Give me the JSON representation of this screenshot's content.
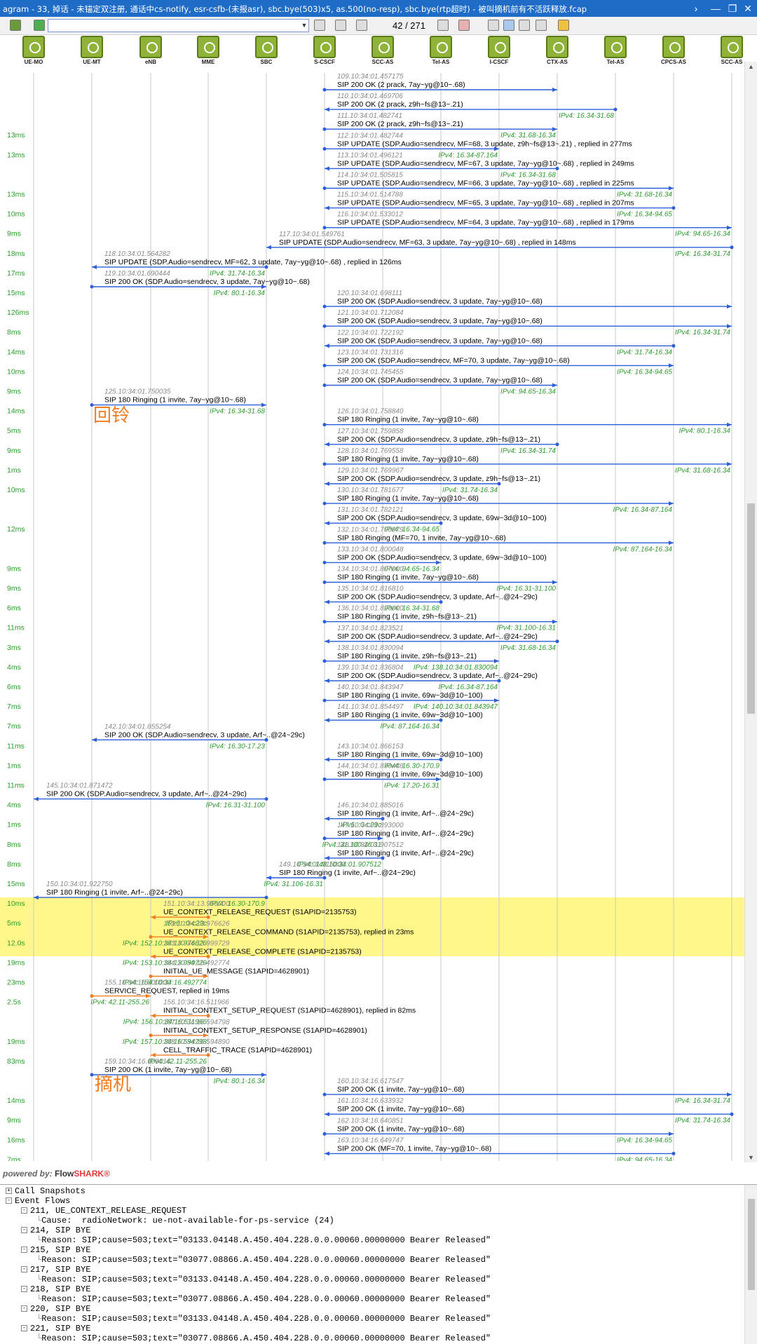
{
  "window": {
    "title": "agram - 33, 掉话 - 未锚定双注册, 通话中cs-notify, esr-csfb-(未报asr), sbc.bye(503)x5, as.500(no-resp), sbc.bye(rtp超时) - 被叫摘机前有不活跃释放.fcap",
    "close": "✕",
    "max": "❐",
    "min": "—",
    "next": "›"
  },
  "toolbar": {
    "page": "42 / 271"
  },
  "entities": [
    "UE-MO",
    "UE-MT",
    "eNB",
    "MME",
    "SBC",
    "S-CSCF",
    "SCC-AS",
    "Tel-AS",
    "I-CSCF",
    "CTX-AS",
    "Tel-AS",
    "CPCS-AS",
    "SCC-AS"
  ],
  "annotations": {
    "ringback": "回铃",
    "offhook": "摘机"
  },
  "colors": {
    "signal": "#2d5fd8",
    "arrow_red": "#f07d23",
    "highlight": "#fff78a",
    "delta": "#2a9d2a",
    "ipv": "#2e9b2e"
  },
  "messages": [
    {
      "d": "",
      "id": "109.10:34:01.457175",
      "t": "SIP 200 OK (2 prack, 7ay~yg@10~.68)",
      "ip": "",
      "f": 5,
      "to": 9
    },
    {
      "d": "",
      "id": "110.10:34:01.469706",
      "t": "SIP 200 OK (2 prack, z9h~fs@13~.21)",
      "ip": "IPv4: 16.34-31.68",
      "f": 10,
      "to": 5
    },
    {
      "d": "13ms",
      "id": "111.10:34:01.482741",
      "t": "SIP 200 OK (2 prack, z9h~fs@13~.21)",
      "ip": "IPv4: 31.68-16.34",
      "f": 5,
      "to": 9
    },
    {
      "d": "13ms",
      "id": "112.10:34:01.482744",
      "t": "SIP UPDATE (SDP.Audio=sendrecv, MF=68, 3 update, z9h~fs@13~.21) , replied in 277ms",
      "ip": "IPv4: 16.34-87.164",
      "f": 5,
      "to": 8
    },
    {
      "d": "",
      "id": "113.10:34:01.496121",
      "t": "SIP UPDATE (SDP.Audio=sendrecv, MF=67, 3 update, 7ay~yg@10~.68) , replied in 249ms",
      "ip": "IPv4: 16.34-31.68",
      "f": 9,
      "to": 5
    },
    {
      "d": "13ms",
      "id": "114.10:34:01.505815",
      "t": "SIP UPDATE (SDP.Audio=sendrecv, MF=66, 3 update, 7ay~yg@10~.68) , replied in 225ms",
      "ip": "IPv4: 31.68-16.34",
      "f": 5,
      "to": 11
    },
    {
      "d": "10ms",
      "id": "115.10:34:01.514788",
      "t": "SIP UPDATE (SDP.Audio=sendrecv, MF=65, 3 update, 7ay~yg@10~.68) , replied in 207ms",
      "ip": "IPv4: 16.34-94.65",
      "f": 11,
      "to": 5
    },
    {
      "d": "9ms",
      "id": "116.10:34:01.533012",
      "t": "SIP UPDATE (SDP.Audio=sendrecv, MF=64, 3 update, 7ay~yg@10~.68) , replied in 179ms",
      "ip": "IPv4: 94.65-16.34",
      "f": 5,
      "to": 12
    },
    {
      "d": "18ms",
      "id": "117.10:34:01.549761",
      "t": "SIP UPDATE (SDP.Audio=sendrecv, MF=63, 3 update, 7ay~yg@10~.68) , replied in 148ms",
      "ip": "IPv4: 16.34-31.74",
      "f": 12,
      "to": 4
    },
    {
      "d": "17ms",
      "id": "118.10:34:01.564282",
      "t": "SIP UPDATE (SDP.Audio=sendrecv, MF=62, 3 update, 7ay~yg@10~.68) , replied in 126ms",
      "ip": "IPv4: 31.74-16.34",
      "f": 4,
      "to": 1
    },
    {
      "d": "15ms",
      "id": "119.10:34:01.690444",
      "t": "SIP 200 OK (SDP.Audio=sendrecv, 3 update, 7ay~yg@10~.68)",
      "ip": "IPv4: 80.1-16.34",
      "f": 1,
      "to": 4
    },
    {
      "d": "126ms",
      "id": "120.10:34:01.698111",
      "t": "SIP 200 OK (SDP.Audio=sendrecv, 3 update, 7ay~yg@10~.68)",
      "ip": "",
      "f": 5,
      "to": 12
    },
    {
      "d": "8ms",
      "id": "121.10:34:01.712084",
      "t": "SIP 200 OK (SDP.Audio=sendrecv, 3 update, 7ay~yg@10~.68)",
      "ip": "IPv4: 16.34-31.74",
      "f": 5,
      "to": 12
    },
    {
      "d": "14ms",
      "id": "122.10:34:01.722192",
      "t": "SIP 200 OK (SDP.Audio=sendrecv, 3 update, 7ay~yg@10~.68)",
      "ip": "IPv4: 31.74-16.34",
      "f": 11,
      "to": 5
    },
    {
      "d": "10ms",
      "id": "123.10:34:01.731316",
      "t": "SIP 200 OK (SDP.Audio=sendrecv, MF=70, 3 update, 7ay~yg@10~.68)",
      "ip": "IPv4: 16.34-94.65",
      "f": 5,
      "to": 11
    },
    {
      "d": "9ms",
      "id": "124.10:34:01.745455",
      "t": "SIP 200 OK (SDP.Audio=sendrecv, 3 update, 7ay~yg@10~.68)",
      "ip": "IPv4: 94.65-16.34",
      "f": 5,
      "to": 9
    },
    {
      "d": "14ms",
      "id": "125.10:34:01.750035",
      "t": "SIP 180 Ringing (1 invite, 7ay~yg@10~.68)",
      "ip": "IPv4: 16.34-31.68",
      "f": 1,
      "to": 4
    },
    {
      "d": "5ms",
      "id": "126.10:34:01.758840",
      "t": "SIP 180 Ringing (1 invite, 7ay~yg@10~.68)",
      "ip": "IPv4: 80.1-16.34",
      "f": 5,
      "to": 12
    },
    {
      "d": "9ms",
      "id": "127.10:34:01.759858",
      "t": "SIP 200 OK (SDP.Audio=sendrecv, 3 update, z9h~fs@13~.21)",
      "ip": "IPv4: 16.34-31.74",
      "f": 9,
      "to": 5
    },
    {
      "d": "1ms",
      "id": "128.10:34:01.769558",
      "t": "SIP 180 Ringing (1 invite, 7ay~yg@10~.68)",
      "ip": "IPv4: 31.68-16.34",
      "f": 5,
      "to": 12
    },
    {
      "d": "10ms",
      "id": "129.10:34:01.769967",
      "t": "SIP 200 OK (SDP.Audio=sendrecv, 3 update, z9h~fs@13~.21)",
      "ip": "IPv4: 31.74-16.34",
      "f": 8,
      "to": 5
    },
    {
      "d": "",
      "id": "130.10:34:01.781677",
      "t": "SIP 180 Ringing (1 invite, 7ay~yg@10~.68)",
      "ip": "IPv4: 16.34-87.164",
      "f": 5,
      "to": 11
    },
    {
      "d": "12ms",
      "id": "131.10:34:01.782121",
      "t": "SIP 200 OK (SDP.Audio=sendrecv, 3 update, 69w~3d@10~100)",
      "ip": "IPv4: 16.34-94.65",
      "f": 7,
      "to": 5
    },
    {
      "d": "",
      "id": "132.10:34:01.790979",
      "t": "SIP 180 Ringing (MF=70, 1 invite, 7ay~yg@10~.68)",
      "ip": "IPv4: 87.164-16.34",
      "f": 5,
      "to": 11
    },
    {
      "d": "9ms",
      "id": "133.10:34:01.800048",
      "t": "SIP 200 OK (SDP.Audio=sendrecv, 3 update, 69w~3d@10~100)",
      "ip": "IPv4: 94.65-16.34",
      "f": 5,
      "to": 7
    },
    {
      "d": "9ms",
      "id": "134.10:34:01.807000",
      "t": "SIP 180 Ringing (1 invite, 7ay~yg@10~.68)",
      "ip": "IPv4: 16.31-31.100",
      "f": 5,
      "to": 9
    },
    {
      "d": "6ms",
      "id": "135.10:34:01.816810",
      "t": "SIP 200 OK (SDP.Audio=sendrecv, 3 update, Arf~..@24~29c)",
      "ip": "IPv4: 16.34-31.68",
      "f": 7,
      "to": 5
    },
    {
      "d": "11ms",
      "id": "136.10:34:01.820000",
      "t": "SIP 180 Ringing (1 invite, z9h~fs@13~.21)",
      "ip": "IPv4: 31.100-16.31",
      "f": 5,
      "to": 9
    },
    {
      "d": "3ms",
      "id": "137.10:34:01.823521",
      "t": "SIP 200 OK (SDP.Audio=sendrecv, 3 update, Arf~..@24~29c)",
      "ip": "IPv4: 31.68-16.34",
      "f": 9,
      "to": 5
    },
    {
      "d": "4ms",
      "id": "138.10:34:01.830094",
      "t": "SIP 180 Ringing (1 invite, z9h~fs@13~.21)",
      "ip": "IPv4: 138.10:34:01.830094",
      "f": 5,
      "to": 8
    },
    {
      "d": "6ms",
      "id": "139.10:34:01.836804",
      "t": "SIP 200 OK (SDP.Audio=sendrecv, 3 update, Arf~..@24~29c)",
      "ip": "IPv4: 16.34-87.164",
      "f": 8,
      "to": 5
    },
    {
      "d": "7ms",
      "id": "140.10:34:01.843947",
      "t": "SIP 180 Ringing (1 invite, 69w~3d@10~100)",
      "ip": "IPv4: 140.10:34:01.843947",
      "f": 5,
      "to": 8
    },
    {
      "d": "7ms",
      "id": "141.10:34:01.854497",
      "t": "SIP 180 Ringing (1 invite, 69w~3d@10~100)",
      "ip": "IPv4: 87.164-16.34",
      "f": 7,
      "to": 5
    },
    {
      "d": "11ms",
      "id": "142.10:34:01.855254",
      "t": "SIP 200 OK (SDP.Audio=sendrecv, 3 update, Arf~..@24~29c)",
      "ip": "IPv4: 16.30-17.23",
      "f": 4,
      "to": 1
    },
    {
      "d": "1ms",
      "id": "143.10:34:01.866153",
      "t": "SIP 180 Ringing (1 invite, 69w~3d@10~100)",
      "ip": "IPv4: 16.30-170.9",
      "f": 7,
      "to": 5
    },
    {
      "d": "11ms",
      "id": "144.10:34:01.870448",
      "t": "SIP 180 Ringing (1 invite, 69w~3d@10~100)",
      "ip": "IPv4: 17.20-16.31",
      "f": 5,
      "to": 7
    },
    {
      "d": "4ms",
      "id": "145.10:34:01.871472",
      "t": "SIP 200 OK (SDP.Audio=sendrecv, 3 update, Arf~..@24~29c)",
      "ip": "IPv4: 16.31-31.100",
      "f": 4,
      "to": 0
    },
    {
      "d": "1ms",
      "id": "146.10:34:01.885016",
      "t": "SIP 180 Ringing (1 invite, Arf~..@24~29c)",
      "ip": "IPv6: :0-c29c",
      "f": 6,
      "to": 5
    },
    {
      "d": "8ms",
      "id": "147.10:34:01.893000",
      "t": "SIP 180 Ringing (1 invite, Arf~..@24~29c)",
      "ip": "IPv4: 31.100-16.31",
      "f": 5,
      "to": 6
    },
    {
      "d": "8ms",
      "id": "148.10:34:01.907512",
      "t": "SIP 180 Ringing (1 invite, Arf~..@24~29c)",
      "ip": "IPv4: 148.10:34:01.907512",
      "f": 6,
      "to": 5
    },
    {
      "d": "15ms",
      "id": "149.10:34:01.915000",
      "t": "SIP 180 Ringing (1 invite, Arf~..@24~29c)",
      "ip": "IPv4: 31.106-16.31",
      "f": 5,
      "to": 4
    },
    {
      "d": "10ms",
      "id": "150.10:34:01.922750",
      "t": "SIP 180 Ringing (1 invite, Arf~..@24~29c)",
      "ip": "IPv4: 16.30-170.9",
      "f": 4,
      "to": 0
    },
    {
      "d": "5ms",
      "id": "151.10:34:13.950000",
      "t": "UE_CONTEXT_RELEASE_REQUEST (S1APID=2135753)",
      "ip": "IPv6: :0-c29c",
      "f": 3,
      "to": 2,
      "hl": 1
    },
    {
      "d": "12.0s",
      "id": "152.10:34:13.976626",
      "t": "UE_CONTEXT_RELEASE_COMMAND (S1APID=2135753), replied in 23ms",
      "ip": "IPv4: 152.10:34:13.976626",
      "f": 2,
      "to": 3,
      "hl": 1
    },
    {
      "d": "19ms",
      "id": "153.10:34:13.999729",
      "t": "UE_CONTEXT_RELEASE_COMPLETE (S1APID=2135753)",
      "ip": "IPv4: 153.10:34:13.999729",
      "f": 3,
      "to": 2,
      "hl": 1
    },
    {
      "d": "23ms",
      "id": "154.10:34:16.492774",
      "t": "INITIAL_UE_MESSAGE (S1APID=4628901)",
      "ip": "IPv4: 154.10:34:16.492774",
      "f": 2,
      "to": 3
    },
    {
      "d": "2.5s",
      "id": "155.10:34:16.500000",
      "t": "SERVICE_REQUEST, replied in 19ms",
      "ip": "IPv4: 42.11-255.26",
      "f": 1,
      "to": 2
    },
    {
      "d": "",
      "id": "156.10:34:16.511966",
      "t": "INITIAL_CONTEXT_SETUP_REQUEST (S1APID=4628901), replied in 82ms",
      "ip": "IPv4: 156.10:34:16.511966",
      "f": 3,
      "to": 2
    },
    {
      "d": "19ms",
      "id": "157.10:34:16.594798",
      "t": "INITIAL_CONTEXT_SETUP_RESPONSE (S1APID=4628901)",
      "ip": "IPv4: 157.10:34:16.594798",
      "f": 2,
      "to": 3
    },
    {
      "d": "83ms",
      "id": "158.10:34:16.594890",
      "t": "CELL_TRAFFIC_TRACE (S1APID=4628901)",
      "ip": "IPv4: 42.11-255.26",
      "f": 3,
      "to": 2
    },
    {
      "d": "",
      "id": "159.10:34:16.609016",
      "t": "SIP 200 OK (1 invite, 7ay~yg@10~.68)",
      "ip": "IPv4: 80.1-16.34",
      "f": 1,
      "to": 4
    },
    {
      "d": "14ms",
      "id": "160.10:34:16.617547",
      "t": "SIP 200 OK (1 invite, 7ay~yg@10~.68)",
      "ip": "IPv4: 16.34-31.74",
      "f": 5,
      "to": 12
    },
    {
      "d": "9ms",
      "id": "161.10:34:16.633932",
      "t": "SIP 200 OK (1 invite, 7ay~yg@10~.68)",
      "ip": "IPv4: 31.74-16.34",
      "f": 12,
      "to": 5
    },
    {
      "d": "16ms",
      "id": "162.10:34:16.640851",
      "t": "SIP 200 OK (1 invite, 7ay~yg@10~.68)",
      "ip": "IPv4: 16.34-94.65",
      "f": 5,
      "to": 11
    },
    {
      "d": "7ms",
      "id": "163.10:34:16.649747",
      "t": "SIP 200 OK (MF=70, 1 invite, 7ay~yg@10~.68)",
      "ip": "IPv4: 94.65-16.34",
      "f": 11,
      "to": 5
    },
    {
      "d": "9ms",
      "id": "",
      "t": "",
      "ip": "",
      "f": 5,
      "to": 5
    }
  ],
  "powered": {
    "prefix": "powered by:",
    "flow": "Flow",
    "shark": "SHARK®"
  },
  "tree": [
    {
      "lvl": 0,
      "pm": "+",
      "text": "Call Snapshots"
    },
    {
      "lvl": 0,
      "pm": "-",
      "text": "Event Flows"
    },
    {
      "lvl": 1,
      "pm": "-",
      "text": "211, UE_CONTEXT_RELEASE_REQUEST"
    },
    {
      "lvl": 2,
      "pm": "",
      "text": "Cause:  radioNetwork: ue-not-available-for-ps-service (24)"
    },
    {
      "lvl": 1,
      "pm": "-",
      "text": "214, SIP BYE"
    },
    {
      "lvl": 2,
      "pm": "",
      "text": "Reason: SIP;cause=503;text=\"03133.04148.A.450.404.228.0.0.00060.00000000 Bearer Released\""
    },
    {
      "lvl": 1,
      "pm": "-",
      "text": "215, SIP BYE"
    },
    {
      "lvl": 2,
      "pm": "",
      "text": "Reason: SIP;cause=503;text=\"03077.08866.A.450.404.228.0.0.00060.00000000 Bearer Released\""
    },
    {
      "lvl": 1,
      "pm": "-",
      "text": "217, SIP BYE"
    },
    {
      "lvl": 2,
      "pm": "",
      "text": "Reason: SIP;cause=503;text=\"03133.04148.A.450.404.228.0.0.00060.00000000 Bearer Released\""
    },
    {
      "lvl": 1,
      "pm": "-",
      "text": "218, SIP BYE"
    },
    {
      "lvl": 2,
      "pm": "",
      "text": "Reason: SIP;cause=503;text=\"03077.08866.A.450.404.228.0.0.00060.00000000 Bearer Released\""
    },
    {
      "lvl": 1,
      "pm": "-",
      "text": "220, SIP BYE"
    },
    {
      "lvl": 2,
      "pm": "",
      "text": "Reason: SIP;cause=503;text=\"03133.04148.A.450.404.228.0.0.00060.00000000 Bearer Released\""
    },
    {
      "lvl": 1,
      "pm": "-",
      "text": "221, SIP BYE"
    },
    {
      "lvl": 2,
      "pm": "",
      "text": "Reason: SIP;cause=503;text=\"03077.08866.A.450.404.228.0.0.00060.00000000 Bearer Released\""
    }
  ]
}
